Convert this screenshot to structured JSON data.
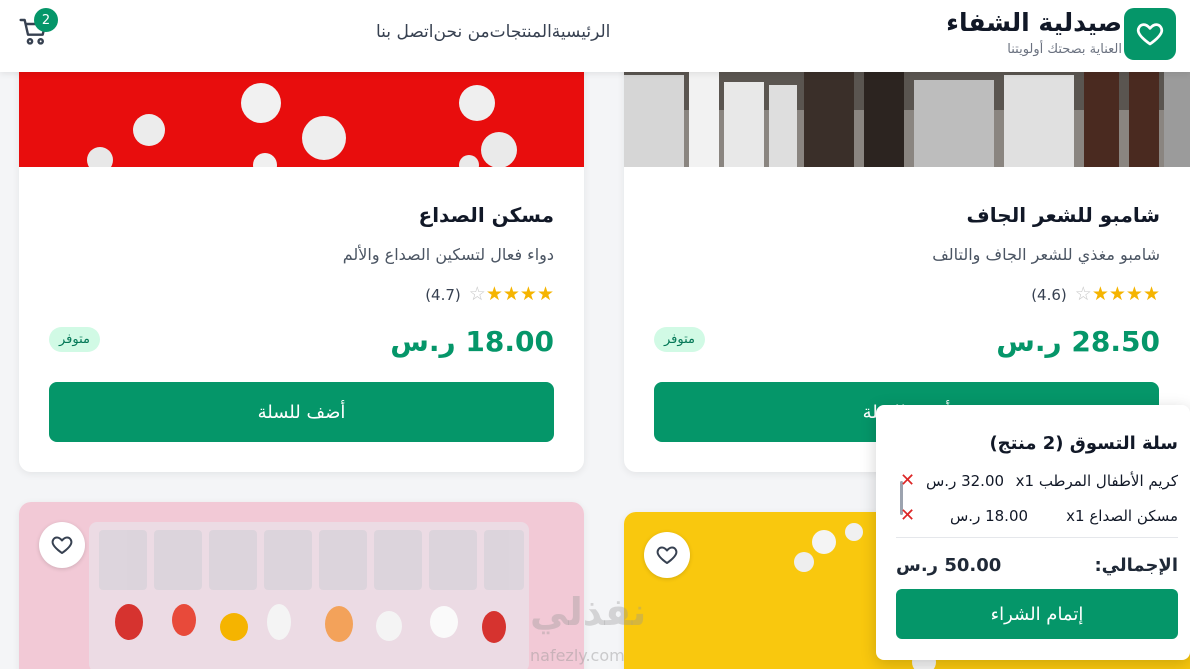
{
  "header": {
    "brand_title": "صيدلية الشفاء",
    "brand_subtitle": "العناية بصحتك أولويتنا",
    "logo_icon": "heart-icon",
    "nav": [
      "الرئيسية",
      "المنتجات",
      "من نحن",
      "اتصل بنا"
    ],
    "cart_icon": "cart-icon",
    "cart_count": "2"
  },
  "products": [
    {
      "name": "مسكن الصداع",
      "description": "دواء فعال لتسكين الصداع والألم",
      "rating_text": "(4.7)",
      "rating": 4.7,
      "price": "18.00 ر.س",
      "badge": "متوفر",
      "button": "أضف للسلة"
    },
    {
      "name": "شامبو للشعر الجاف",
      "description": "شامبو مغذي للشعر الجاف والتالف",
      "rating_text": "(4.6)",
      "rating": 4.6,
      "price": "28.50 ر.س",
      "badge": "متوفر",
      "button": "أضف للسلة"
    }
  ],
  "cart": {
    "title": "سلة التسوق (2 منتج)",
    "items": [
      {
        "name": "كريم الأطفال المرطب x1",
        "price": "32.00 ر.س"
      },
      {
        "name": "مسكن الصداع x1",
        "price": "18.00 ر.س"
      }
    ],
    "total_label": "الإجمالي:",
    "total_value": "50.00 ر.س",
    "checkout": "إتمام الشراء"
  },
  "watermark": {
    "text": "نفذلي",
    "sub": "nafezly.com"
  },
  "colors": {
    "primary": "#059669",
    "star": "#f5b400",
    "badge_bg": "#d1fae5",
    "remove": "#dc2626"
  }
}
